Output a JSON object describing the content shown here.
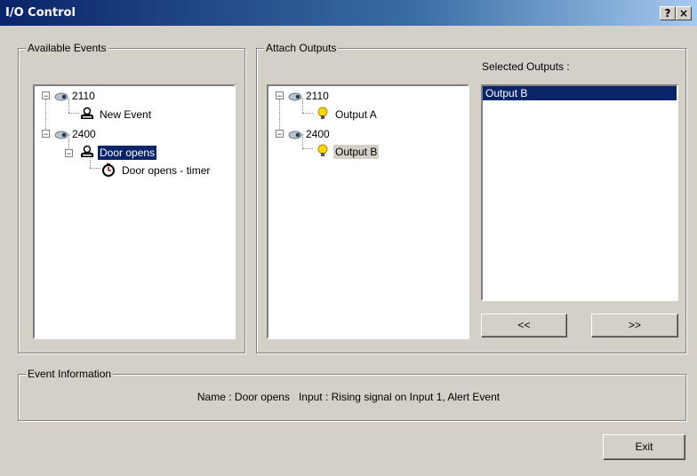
{
  "window": {
    "title": "I/O Control",
    "help_glyph": "?",
    "close_glyph": "×"
  },
  "available_events": {
    "legend": "Available Events",
    "tree": [
      {
        "label": "2110",
        "icon": "camera-icon"
      },
      {
        "label": "New Event",
        "icon": "event-icon"
      },
      {
        "label": "2400",
        "icon": "camera-icon"
      },
      {
        "label": "Door opens",
        "icon": "event-icon",
        "selected": true
      },
      {
        "label": "Door opens - timer",
        "icon": "timer-icon"
      }
    ]
  },
  "attach_outputs": {
    "legend": "Attach Outputs",
    "tree": [
      {
        "label": "2110",
        "icon": "camera-icon"
      },
      {
        "label": "Output A",
        "icon": "bulb-icon"
      },
      {
        "label": "2400",
        "icon": "camera-icon"
      },
      {
        "label": "Output B",
        "icon": "bulb-icon",
        "highlighted": true
      }
    ],
    "selected_outputs_label": "Selected Outputs :",
    "selected_outputs": [
      "Output B"
    ],
    "remove_button": "<<",
    "add_button": ">>"
  },
  "event_information": {
    "legend": "Event Information",
    "text": "Name : Door opens   Input : Rising signal on Input 1, Alert Event"
  },
  "exit_button": "Exit",
  "colors": {
    "face": "#d4d0c8",
    "selection": "#0a246a",
    "title_gradient_start": "#0a246a",
    "title_gradient_end": "#a6caf0"
  }
}
